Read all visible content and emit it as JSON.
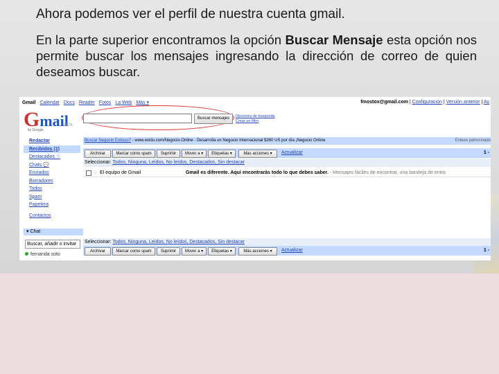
{
  "slide": {
    "title": "Ahora podemos ver el perfil de nuestra cuenta gmail.",
    "para_before": "En la parte superior encontramos la opción ",
    "para_bold": "Buscar Mensaje",
    "para_after": " esta opción nos permite buscar los mensajes ingresando la dirección de correo de quien deseamos buscar."
  },
  "gmail": {
    "nav": [
      "Gmail",
      "Calendar",
      "Docs",
      "Reader",
      "Fotos",
      "La Web",
      "Más ▾"
    ],
    "account_email": "fmostox@gmail.com",
    "account_links": [
      "Configuración",
      "Versión anterior",
      "Ay"
    ],
    "logo_g": "G",
    "logo_mail": "mail",
    "logo_by": "by Google",
    "logo_beta": "BETA",
    "search_button": "Buscar mensajes",
    "search_options": "Opciones de búsqueda",
    "create_filter": "Crear un filtro",
    "sidebar": [
      "Redactar",
      "Recibidos (1)",
      "Destacados ☆",
      "Chats 💬",
      "Enviados",
      "Borradores",
      "Todos",
      "Spam",
      "Papelera",
      "Contactos"
    ],
    "chat_label": "▾ Chat",
    "chat_input": "Buscar, añadir o invitar",
    "chat_user": "fernanda soto",
    "promo_link": "Buscar Negocio Exitoso?",
    "promo_text": " - www.exidu.com/Negocio.Online - Desarrolla un Negocio Internacional $260 US por día ¡Negocio Online",
    "promo_sponsor": "Enlace patrocinado",
    "toolbar": {
      "archive": "Archivar",
      "report_spam": "Marcar como spam",
      "delete": "Suprimir",
      "move": "Mover a ▾",
      "labels": "Etiquetas ▾",
      "more": "Más acciones ▾",
      "refresh": "Actualizar",
      "count": "1 -"
    },
    "select_label": "Seleccionar: ",
    "select_options": "Todos, Ninguna, Leídos, No leídos, Destacados, Sin destacar",
    "message": {
      "from": "El equipo de Gmail",
      "subject": "Gmail es diferente. Aquí encontrarás todo lo que debes saber.",
      "snippet": " - Mensajes fáciles de encontrar, una bandeja de entra"
    }
  }
}
